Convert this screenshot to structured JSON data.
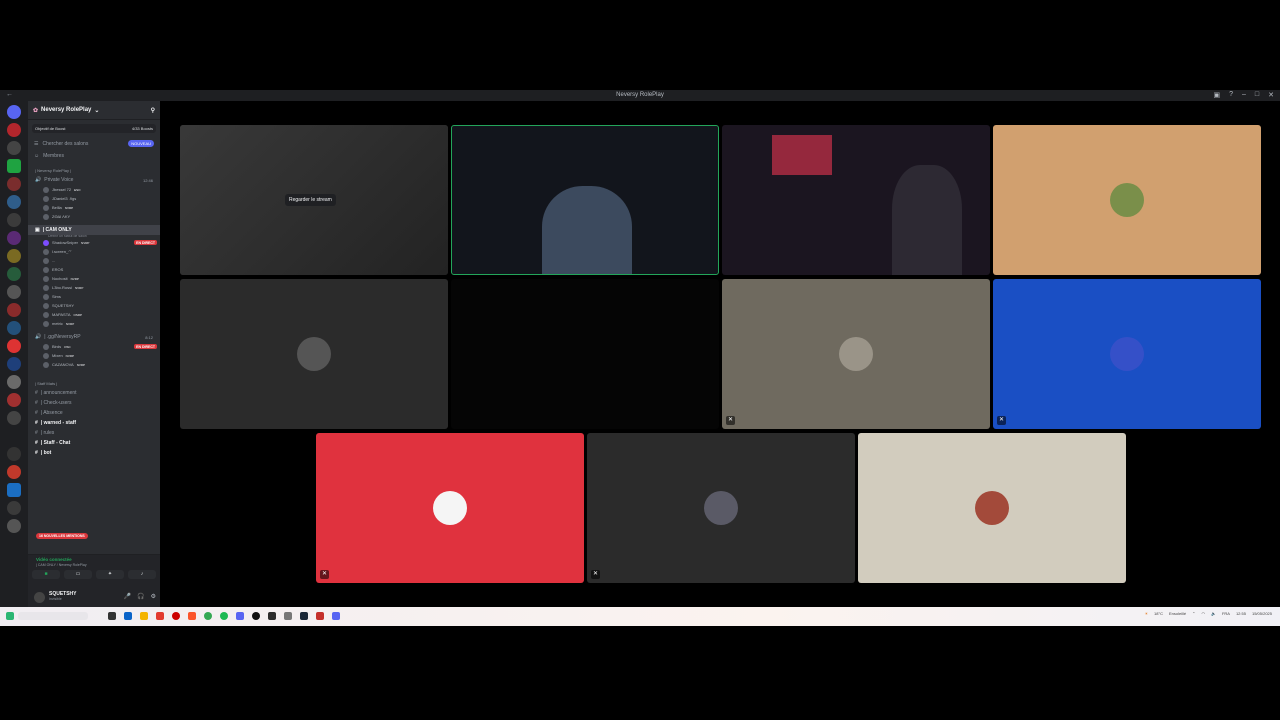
{
  "window": {
    "title": "Neversy RolePlay"
  },
  "guild": {
    "name": "Neversy RolePlay",
    "boost_label": "Objectif de Boost",
    "boost_count": "4/33 Boosts"
  },
  "nav": {
    "browse": "Chercher des salons",
    "browse_badge": "NOUVEAU",
    "members": "Membres"
  },
  "cat1": "| Neversy RolePlay |",
  "private_voice": {
    "name": "Private Voice",
    "time": "12:46"
  },
  "pv_users": [
    "Jbessel 72",
    "JDaniel3 .9gs",
    "Bellla",
    "ΖΘΔΙ ΛΚΥ"
  ],
  "pv_tags": [
    "ESO",
    "",
    "NVRP",
    ""
  ],
  "cam_only": {
    "name": "| CAM ONLY",
    "sub": "Définir un statut de salon"
  },
  "cam_users": [
    "ShadowSniper",
    "l.screen_ᐟᐟ",
    "...",
    "EROS",
    "Nochosit",
    "L3bo.Rossi",
    "Sims",
    "SQUETSHY",
    "MAPASTA",
    "metric"
  ],
  "cam_tags": [
    "NVRP",
    "",
    "",
    "",
    "NVRP",
    "NVRP",
    "",
    "",
    "OSRP",
    "NVRP"
  ],
  "live_label": "EN DIRECT",
  "nrp_channel": {
    "name": "| .gg/NeversyRP",
    "time": "8:12"
  },
  "nrp_users": [
    "Birds",
    "Mixen",
    "CAZANOVA"
  ],
  "nrp_tags": [
    "OSC",
    "NVRP",
    "NVRP"
  ],
  "cat2": "| Staff Mats |",
  "text_channels": [
    "| announcement",
    "| Check-users",
    "| Absence",
    "| warned - staff",
    "| rules",
    "| Staff - Chat",
    "| bot"
  ],
  "new_mentions": "16 NOUVELLES MENTIONS",
  "voice": {
    "status": "Vidéo connectée",
    "sub": "| CAM ONLY / Neversy RolePlay"
  },
  "user": {
    "name": "SQUETSHY",
    "status": "Invisible"
  },
  "stream": {
    "watch_label": "Regarder le stream"
  },
  "taskbar": {
    "weather": "18°C",
    "weather_sub": "Ensoleillé",
    "lang": "FRA",
    "time": "12:55",
    "date": "15/05/2025"
  },
  "colors": {
    "tile_tan": "#d1a06f",
    "tile_blue": "#1a4fc4",
    "tile_red": "#e0323e",
    "tile_taupe": "#6f6a5f",
    "tile_cream": "#d2ccbe",
    "tile_gray": "#2b2b2b",
    "speaking": "#23a55a",
    "live": "#da373c"
  }
}
